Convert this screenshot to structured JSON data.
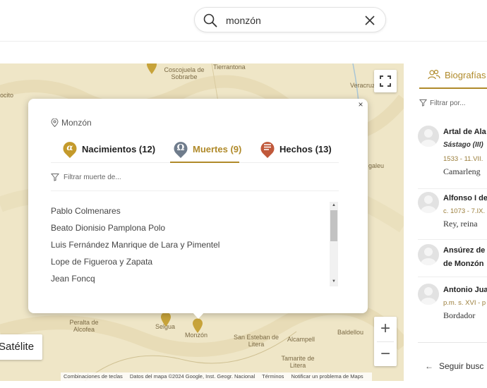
{
  "search": {
    "value": "monzón"
  },
  "map": {
    "labels": [
      "Coscojuela de Sobrarbe",
      "Tierrantona",
      "Veracruz",
      "Monzón",
      "Selgua",
      "Peralta de Alcofea",
      "San Esteban de Litera",
      "Alcampell",
      "Baldellou",
      "Tamarite de Litera",
      "ocito",
      "galeu"
    ],
    "satellite_label": "Satélite",
    "attribution": [
      "Combinaciones de teclas",
      "Datos del mapa ©2024 Google, Inst. Geogr. Nacional",
      "Términos",
      "Notificar un problema de Maps"
    ]
  },
  "popup": {
    "location": "Monzón",
    "tabs": [
      {
        "label": "Nacimientos (12)",
        "active": false,
        "icon": "alpha-badge-icon",
        "color": "#c49a2b"
      },
      {
        "label": "Muertes (9)",
        "active": true,
        "icon": "omega-badge-icon",
        "color": "#6f7c8c"
      },
      {
        "label": "Hechos (13)",
        "active": false,
        "icon": "document-badge-icon",
        "color": "#c0583a"
      }
    ],
    "filter_placeholder": "Filtrar muerte de...",
    "items": [
      "Pablo Colmenares",
      "Beato Dionisio Pamplona Polo",
      "Luis Fernández Manrique de Lara y Pimentel",
      "Lope de Figueroa y Zapata",
      "Jean Foncq"
    ]
  },
  "sidebar": {
    "heading": "Biografías",
    "filter": "Filtrar por...",
    "bios": [
      {
        "name": "Artal de Ala",
        "sub": "Sástago (III)",
        "dates": "1533 - 11.VII.",
        "role": "Camarleng"
      },
      {
        "name": "Alfonso I de",
        "dates": "c. 1073 - 7.IX.",
        "role": "Rey, reina"
      },
      {
        "name": "Ansúrez de",
        "name2": "de Monzón"
      },
      {
        "name": "Antonio Jua",
        "dates": "p.m. s. XVI - p",
        "role": "Bordador"
      }
    ],
    "more": "Seguir busc"
  },
  "colors": {
    "accent": "#b08a2a",
    "map_bg": "#efe6c7"
  }
}
